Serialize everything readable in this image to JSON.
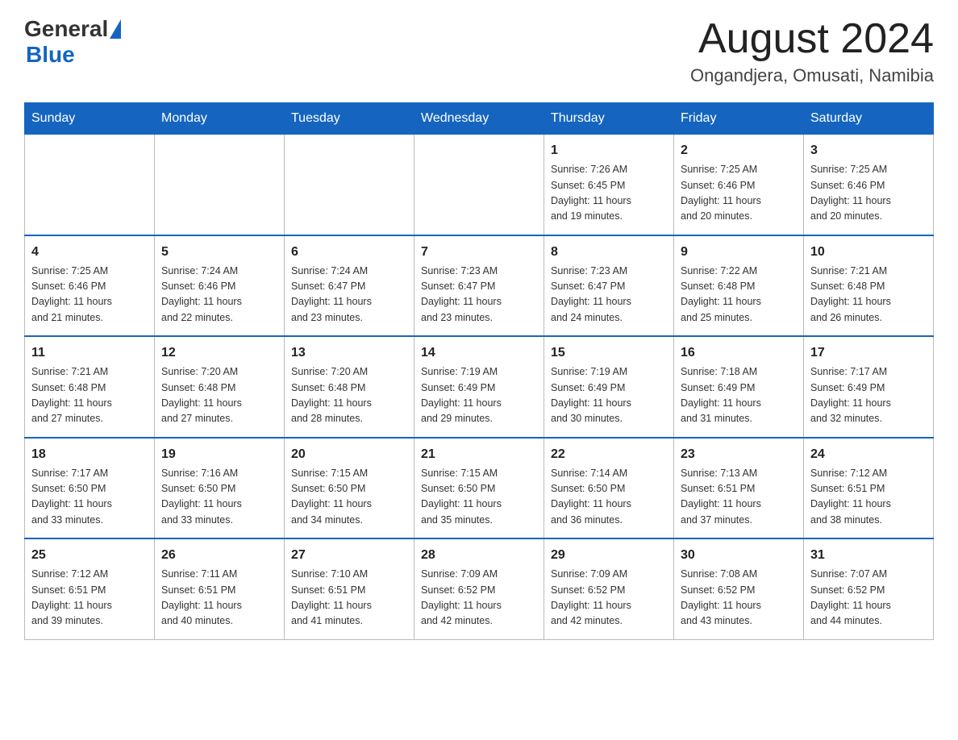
{
  "header": {
    "logo_general": "General",
    "logo_blue": "Blue",
    "month_title": "August 2024",
    "location": "Ongandjera, Omusati, Namibia"
  },
  "days_of_week": [
    "Sunday",
    "Monday",
    "Tuesday",
    "Wednesday",
    "Thursday",
    "Friday",
    "Saturday"
  ],
  "weeks": [
    [
      {
        "day": "",
        "info": ""
      },
      {
        "day": "",
        "info": ""
      },
      {
        "day": "",
        "info": ""
      },
      {
        "day": "",
        "info": ""
      },
      {
        "day": "1",
        "info": "Sunrise: 7:26 AM\nSunset: 6:45 PM\nDaylight: 11 hours\nand 19 minutes."
      },
      {
        "day": "2",
        "info": "Sunrise: 7:25 AM\nSunset: 6:46 PM\nDaylight: 11 hours\nand 20 minutes."
      },
      {
        "day": "3",
        "info": "Sunrise: 7:25 AM\nSunset: 6:46 PM\nDaylight: 11 hours\nand 20 minutes."
      }
    ],
    [
      {
        "day": "4",
        "info": "Sunrise: 7:25 AM\nSunset: 6:46 PM\nDaylight: 11 hours\nand 21 minutes."
      },
      {
        "day": "5",
        "info": "Sunrise: 7:24 AM\nSunset: 6:46 PM\nDaylight: 11 hours\nand 22 minutes."
      },
      {
        "day": "6",
        "info": "Sunrise: 7:24 AM\nSunset: 6:47 PM\nDaylight: 11 hours\nand 23 minutes."
      },
      {
        "day": "7",
        "info": "Sunrise: 7:23 AM\nSunset: 6:47 PM\nDaylight: 11 hours\nand 23 minutes."
      },
      {
        "day": "8",
        "info": "Sunrise: 7:23 AM\nSunset: 6:47 PM\nDaylight: 11 hours\nand 24 minutes."
      },
      {
        "day": "9",
        "info": "Sunrise: 7:22 AM\nSunset: 6:48 PM\nDaylight: 11 hours\nand 25 minutes."
      },
      {
        "day": "10",
        "info": "Sunrise: 7:21 AM\nSunset: 6:48 PM\nDaylight: 11 hours\nand 26 minutes."
      }
    ],
    [
      {
        "day": "11",
        "info": "Sunrise: 7:21 AM\nSunset: 6:48 PM\nDaylight: 11 hours\nand 27 minutes."
      },
      {
        "day": "12",
        "info": "Sunrise: 7:20 AM\nSunset: 6:48 PM\nDaylight: 11 hours\nand 27 minutes."
      },
      {
        "day": "13",
        "info": "Sunrise: 7:20 AM\nSunset: 6:48 PM\nDaylight: 11 hours\nand 28 minutes."
      },
      {
        "day": "14",
        "info": "Sunrise: 7:19 AM\nSunset: 6:49 PM\nDaylight: 11 hours\nand 29 minutes."
      },
      {
        "day": "15",
        "info": "Sunrise: 7:19 AM\nSunset: 6:49 PM\nDaylight: 11 hours\nand 30 minutes."
      },
      {
        "day": "16",
        "info": "Sunrise: 7:18 AM\nSunset: 6:49 PM\nDaylight: 11 hours\nand 31 minutes."
      },
      {
        "day": "17",
        "info": "Sunrise: 7:17 AM\nSunset: 6:49 PM\nDaylight: 11 hours\nand 32 minutes."
      }
    ],
    [
      {
        "day": "18",
        "info": "Sunrise: 7:17 AM\nSunset: 6:50 PM\nDaylight: 11 hours\nand 33 minutes."
      },
      {
        "day": "19",
        "info": "Sunrise: 7:16 AM\nSunset: 6:50 PM\nDaylight: 11 hours\nand 33 minutes."
      },
      {
        "day": "20",
        "info": "Sunrise: 7:15 AM\nSunset: 6:50 PM\nDaylight: 11 hours\nand 34 minutes."
      },
      {
        "day": "21",
        "info": "Sunrise: 7:15 AM\nSunset: 6:50 PM\nDaylight: 11 hours\nand 35 minutes."
      },
      {
        "day": "22",
        "info": "Sunrise: 7:14 AM\nSunset: 6:50 PM\nDaylight: 11 hours\nand 36 minutes."
      },
      {
        "day": "23",
        "info": "Sunrise: 7:13 AM\nSunset: 6:51 PM\nDaylight: 11 hours\nand 37 minutes."
      },
      {
        "day": "24",
        "info": "Sunrise: 7:12 AM\nSunset: 6:51 PM\nDaylight: 11 hours\nand 38 minutes."
      }
    ],
    [
      {
        "day": "25",
        "info": "Sunrise: 7:12 AM\nSunset: 6:51 PM\nDaylight: 11 hours\nand 39 minutes."
      },
      {
        "day": "26",
        "info": "Sunrise: 7:11 AM\nSunset: 6:51 PM\nDaylight: 11 hours\nand 40 minutes."
      },
      {
        "day": "27",
        "info": "Sunrise: 7:10 AM\nSunset: 6:51 PM\nDaylight: 11 hours\nand 41 minutes."
      },
      {
        "day": "28",
        "info": "Sunrise: 7:09 AM\nSunset: 6:52 PM\nDaylight: 11 hours\nand 42 minutes."
      },
      {
        "day": "29",
        "info": "Sunrise: 7:09 AM\nSunset: 6:52 PM\nDaylight: 11 hours\nand 42 minutes."
      },
      {
        "day": "30",
        "info": "Sunrise: 7:08 AM\nSunset: 6:52 PM\nDaylight: 11 hours\nand 43 minutes."
      },
      {
        "day": "31",
        "info": "Sunrise: 7:07 AM\nSunset: 6:52 PM\nDaylight: 11 hours\nand 44 minutes."
      }
    ]
  ]
}
